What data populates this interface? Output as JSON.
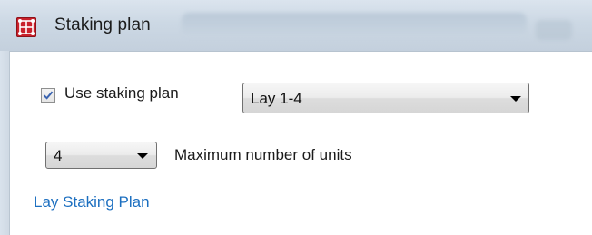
{
  "window": {
    "title": "Staking plan",
    "icon": "app-grid-icon"
  },
  "staking": {
    "use_label": "Use staking plan",
    "use_checked": true,
    "plan_selected": "Lay 1-4",
    "max_units_selected": "4",
    "max_units_label": "Maximum number of units",
    "link_text": "Lay Staking Plan"
  },
  "colors": {
    "titlebar": "#ccd8e4",
    "link": "#1c6fc0",
    "icon_red": "#c9212b"
  }
}
